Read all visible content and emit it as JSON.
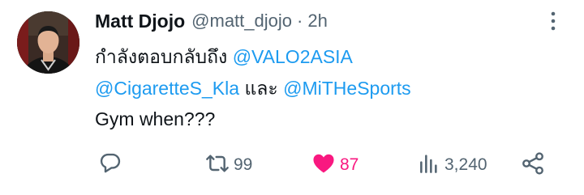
{
  "tweet": {
    "display_name": "Matt Djojo",
    "handle": "@matt_djojo",
    "separator": "·",
    "time": "2h",
    "reply_prefix": "กำลังตอบกลับถึง",
    "mentions": [
      "@VALO2ASIA",
      "@CigaretteS_Kla",
      "@MiTHeSports"
    ],
    "conjunction": "และ",
    "text": "Gym when???"
  },
  "actions": {
    "reply_count": "",
    "retweet_count": "99",
    "like_count": "87",
    "view_count": "3,240"
  },
  "icons": {
    "reply": "reply-icon",
    "retweet": "retweet-icon",
    "like": "heart-icon",
    "views": "views-icon",
    "share": "share-icon",
    "more": "more-vertical-icon"
  },
  "colors": {
    "text": "#0f1419",
    "secondary": "#536471",
    "mention": "#1d9bf0",
    "like": "#f91880"
  }
}
